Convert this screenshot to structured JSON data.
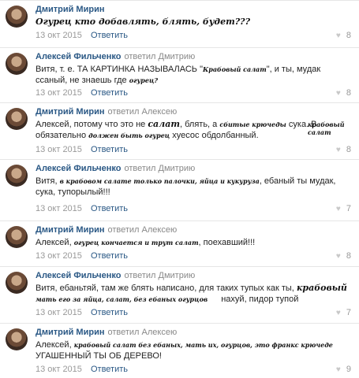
{
  "comments": [
    {
      "author": "Дмитрий Мирин",
      "replied": "",
      "text_parts": [
        "Огурец кто добавлять, блять, будет???"
      ],
      "date": "13 окт 2015",
      "reply": "Ответить",
      "likes": "8"
    },
    {
      "author": "Алексей Фильченко",
      "replied": "ответил Дмитрию",
      "text_a": "Витя, т. е. ТА КАРТИНКА НАЗЫВАЛАСЬ \"",
      "hand_1": "Крабовый салат",
      "text_b": "\", и ты, мудак",
      "text_c": "ссаный, не знаешь где",
      "hand_2": "огурец?",
      "date": "13 окт 2015",
      "reply": "Ответить",
      "likes": "8"
    },
    {
      "author": "Дмитрий Мирин",
      "replied": "ответил Алексею",
      "text_a": "Алексей, потому что это не",
      "hand_1": "салат",
      "text_b": ", блять, а",
      "hand_2": "сбитые крючеды",
      "text_c": "сука. В",
      "hand_3": "крабовый салат",
      "text_d": "обязательно",
      "hand_4": "должен быть огурец",
      "text_e": "хуесос обдолбанный.",
      "date": "13 окт 2015",
      "reply": "Ответить",
      "likes": "8"
    },
    {
      "author": "Алексей Фильченко",
      "replied": "ответил Дмитрию",
      "text_a": "Витя,",
      "hand_1": "в крабовом салате только палочки, яйца и кукуруза",
      "text_b": ", ебаный ты мудак,",
      "text_c": "сука, тупорылый!!!",
      "date": "13 окт 2015",
      "reply": "Ответить",
      "likes": "7"
    },
    {
      "author": "Дмитрий Мирин",
      "replied": "ответил Алексею",
      "text_a": "Алексей,",
      "hand_1": "огурец кончается и трут салат",
      "text_b": ", поехавший!!!",
      "date": "13 окт 2015",
      "reply": "Ответить",
      "likes": "8"
    },
    {
      "author": "Алексей Фильченко",
      "replied": "ответил Дмитрию",
      "text_a": "Витя, ебаньтяй, там же блять написано, для таких тупых как ты,",
      "hand_1": "крабовый",
      "hand_2": "мать его за яйца, салат, без ебаных огурцов",
      "text_b": "нахуй, пидор тупой",
      "date": "13 окт 2015",
      "reply": "Ответить",
      "likes": "7"
    },
    {
      "author": "Дмитрий Мирин",
      "replied": "ответил Алексею",
      "text_a": "Алексей,",
      "hand_1": "крабовый салат без ебаных, мать их, огурцов, это франкс крючеде",
      "text_b": "УГАШЕННЫЙ ТЫ ОБ ДЕРЕВО!",
      "date": "13 окт 2015",
      "reply": "Ответить",
      "likes": "9"
    }
  ]
}
